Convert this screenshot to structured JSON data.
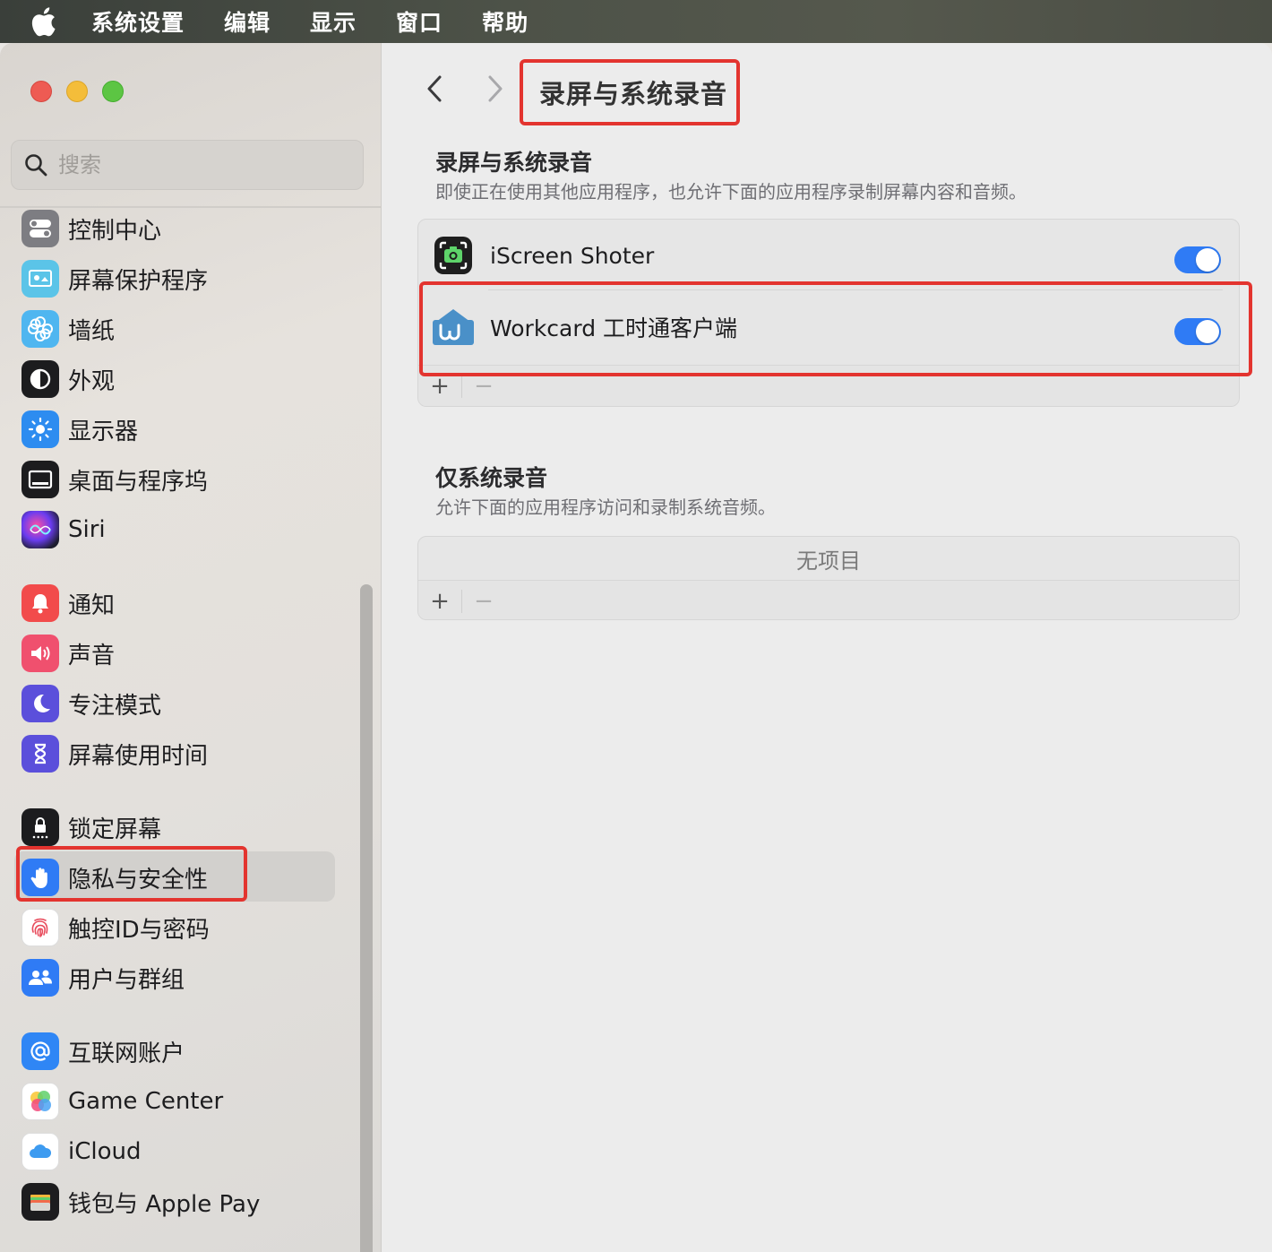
{
  "menubar": {
    "items": [
      "系统设置",
      "编辑",
      "显示",
      "窗口",
      "帮助"
    ]
  },
  "sidebar": {
    "search_placeholder": "搜索",
    "items": [
      {
        "label": "控制中心",
        "icon": "control-center-icon"
      },
      {
        "label": "屏幕保护程序",
        "icon": "screensaver-icon"
      },
      {
        "label": "墙纸",
        "icon": "wallpaper-icon"
      },
      {
        "label": "外观",
        "icon": "appearance-icon"
      },
      {
        "label": "显示器",
        "icon": "displays-icon"
      },
      {
        "label": "桌面与程序坞",
        "icon": "desktop-dock-icon"
      },
      {
        "label": "Siri",
        "icon": "siri-icon"
      },
      {
        "label": "通知",
        "icon": "notifications-icon"
      },
      {
        "label": "声音",
        "icon": "sound-icon"
      },
      {
        "label": "专注模式",
        "icon": "focus-icon"
      },
      {
        "label": "屏幕使用时间",
        "icon": "screen-time-icon"
      },
      {
        "label": "锁定屏幕",
        "icon": "lock-screen-icon"
      },
      {
        "label": "隐私与安全性",
        "icon": "privacy-hand-icon",
        "selected": true
      },
      {
        "label": "触控ID与密码",
        "icon": "touch-id-icon"
      },
      {
        "label": "用户与群组",
        "icon": "users-groups-icon"
      },
      {
        "label": "互联网账户",
        "icon": "internet-accounts-icon"
      },
      {
        "label": "Game Center",
        "icon": "game-center-icon"
      },
      {
        "label": "iCloud",
        "icon": "icloud-icon"
      },
      {
        "label": "钱包与 Apple Pay",
        "icon": "wallet-icon"
      }
    ]
  },
  "main": {
    "title": "录屏与系统录音",
    "section1": {
      "title": "录屏与系统录音",
      "description": "即使正在使用其他应用程序，也允许下面的应用程序录制屏幕内容和音频。",
      "apps": [
        {
          "name": "iScreen Shoter",
          "enabled": true,
          "icon": "iscreen-shoter-icon"
        },
        {
          "name": "Workcard 工时通客户端",
          "enabled": true,
          "icon": "workcard-icon"
        }
      ],
      "add_label": "+",
      "remove_label": "−"
    },
    "section2": {
      "title": "仅系统录音",
      "description": "允许下面的应用程序访问和录制系统音频。",
      "empty_label": "无项目",
      "add_label": "+",
      "remove_label": "−"
    }
  },
  "colors": {
    "toggle_on": "#2f7bf5",
    "highlight_box": "#e3342f"
  }
}
